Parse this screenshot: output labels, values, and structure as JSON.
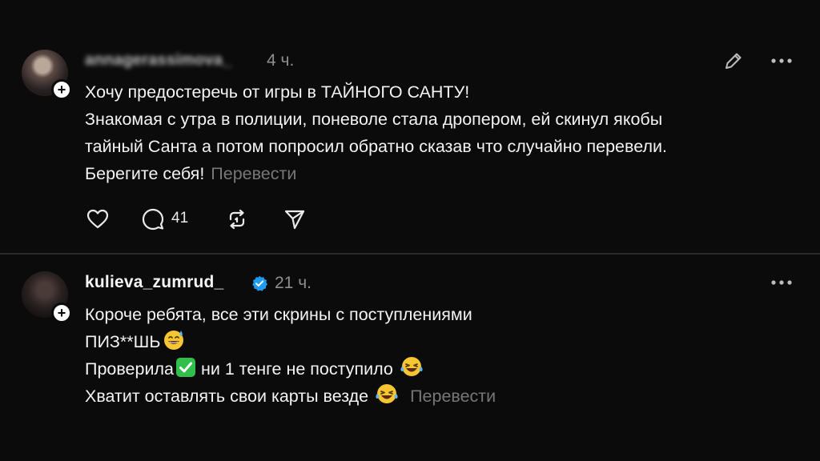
{
  "posts": [
    {
      "username": "annagerassimova_",
      "time": "4 ч.",
      "lines": [
        "Хочу предостеречь от игры в ТАЙНОГО САНТУ!",
        "Знакомая с утра в полиции, поневоле стала дропером, ей скинул якобы",
        "тайный Санта а потом попросил обратно сказав что случайно перевели.",
        "Берегите себя!"
      ],
      "translate": "Перевести",
      "reply_count": "41",
      "icons": [
        "edit-icon",
        "more-icon",
        "heart-icon",
        "comment-icon",
        "repost-icon",
        "share-icon"
      ]
    },
    {
      "username": "kulieva_zumrud_",
      "time": "21 ч.",
      "lines": [
        "Короче ребята, все эти скрины с поступлениями",
        "ПИЗ**ШЬ",
        "Проверила",
        " ни 1 тенге не поступило ",
        "Хватит оставлять свои карты везде "
      ],
      "translate": "Перевести",
      "icons": [
        "verified-icon",
        "more-icon"
      ]
    }
  ],
  "colors": {
    "background": "#0b0b0b",
    "text": "#f3f3f3",
    "muted": "#8e8e8e",
    "verified": "#1d9bf0",
    "check_emoji": "#2fbf4a",
    "emoji_face": "#f6c532"
  }
}
